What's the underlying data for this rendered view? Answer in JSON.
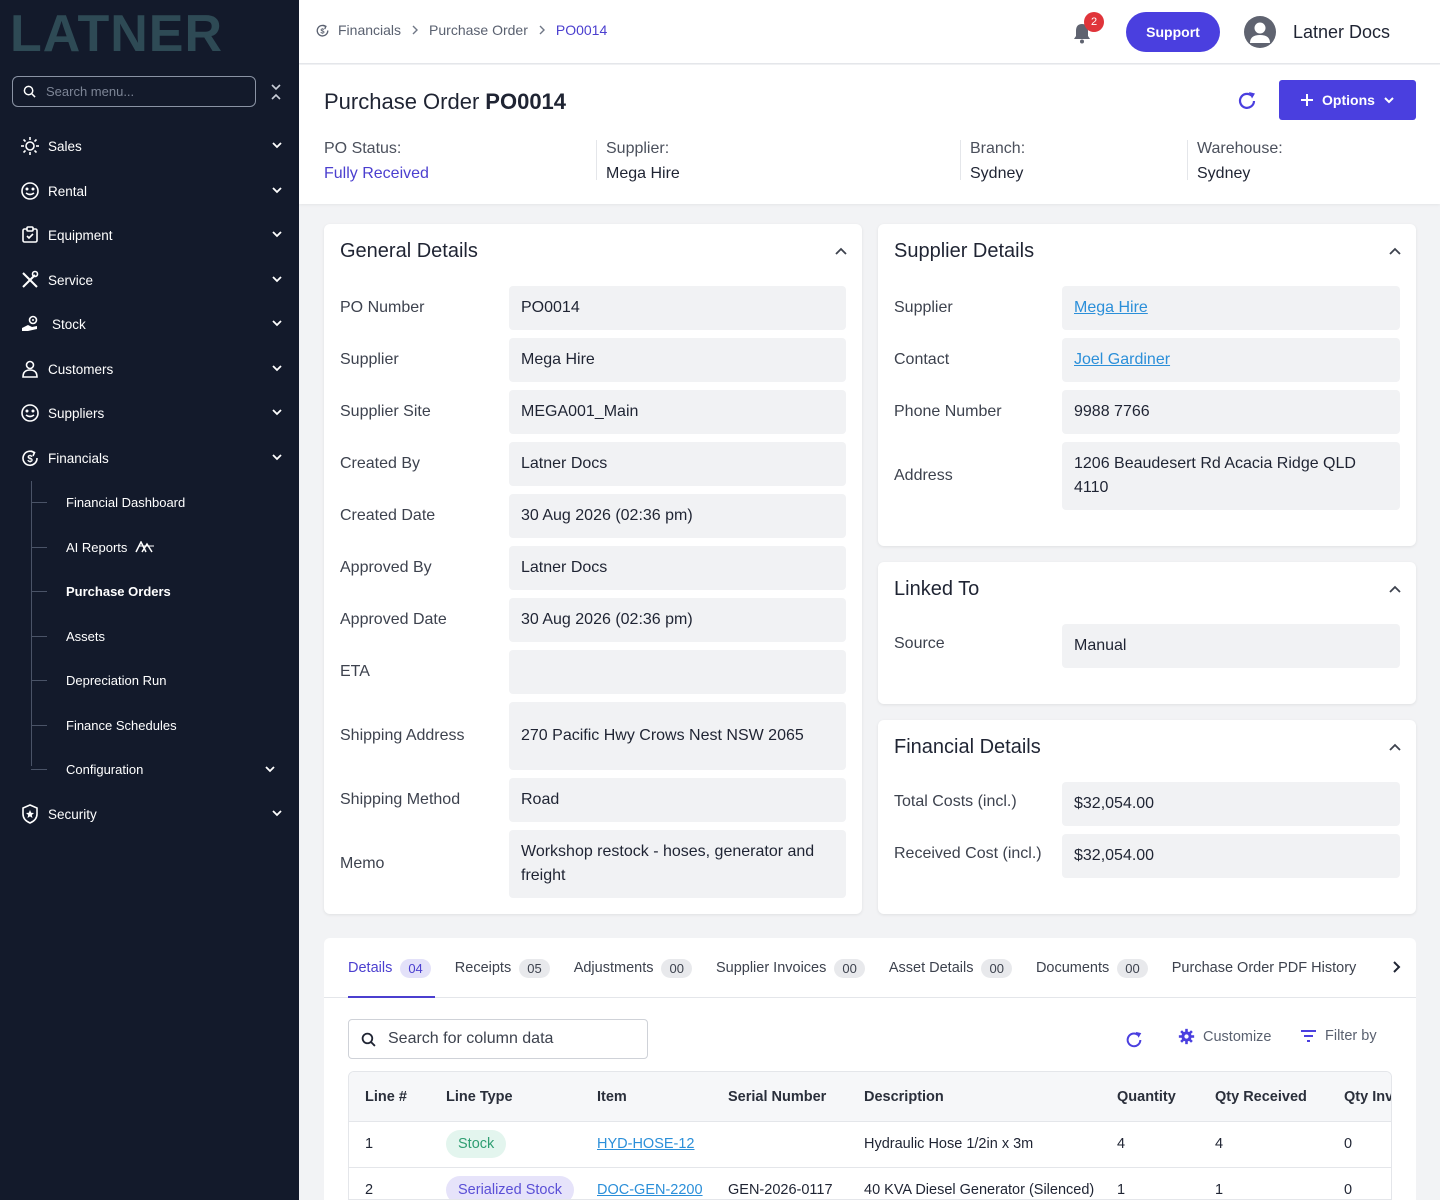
{
  "brand": {
    "logo_text": "LATNER"
  },
  "sidebar": {
    "search_placeholder": "Search menu...",
    "items": [
      {
        "label": "Sales",
        "icon": "sales-icon"
      },
      {
        "label": "Rental",
        "icon": "rental-icon"
      },
      {
        "label": "Equipment",
        "icon": "equipment-icon"
      },
      {
        "label": "Service",
        "icon": "service-icon"
      },
      {
        "label": "Stock",
        "icon": "stock-icon"
      },
      {
        "label": "Customers",
        "icon": "customers-icon"
      },
      {
        "label": "Suppliers",
        "icon": "suppliers-icon"
      },
      {
        "label": "Financials",
        "icon": "financials-icon"
      },
      {
        "label": "Security",
        "icon": "security-icon"
      }
    ],
    "financials_sub": [
      {
        "label": "Financial Dashboard"
      },
      {
        "label": "AI Reports"
      },
      {
        "label": "Purchase Orders",
        "active": true
      },
      {
        "label": "Assets"
      },
      {
        "label": "Depreciation Run"
      },
      {
        "label": "Finance Schedules"
      },
      {
        "label": "Configuration"
      }
    ]
  },
  "topbar": {
    "breadcrumb": [
      "Financials",
      "Purchase Order",
      "PO0014"
    ],
    "notification_count": "2",
    "support_label": "Support",
    "user_name": "Latner Docs"
  },
  "header": {
    "title_prefix": "Purchase Order",
    "title_id": "PO0014",
    "options_label": "Options",
    "fields": [
      {
        "label": "PO Status:",
        "value": "Fully Received"
      },
      {
        "label": "Supplier:",
        "value": "Mega Hire"
      },
      {
        "label": "Branch:",
        "value": "Sydney"
      },
      {
        "label": "Warehouse:",
        "value": "Sydney"
      }
    ]
  },
  "general_details": {
    "title": "General Details",
    "rows": [
      {
        "label": "PO Number",
        "value": "PO0014"
      },
      {
        "label": "Supplier",
        "value": "Mega Hire"
      },
      {
        "label": "Supplier Site",
        "value": "MEGA001_Main"
      },
      {
        "label": "Created By",
        "value": "Latner Docs"
      },
      {
        "label": "Created Date",
        "value": "30 Aug 2026 (02:36 pm)"
      },
      {
        "label": "Approved By",
        "value": "Latner Docs"
      },
      {
        "label": "Approved Date",
        "value": "30 Aug 2026 (02:36 pm)"
      },
      {
        "label": "ETA",
        "value": ""
      },
      {
        "label": "Shipping Address",
        "value": "270 Pacific Hwy Crows Nest NSW 2065"
      },
      {
        "label": "Shipping Method",
        "value": "Road"
      },
      {
        "label": "Memo",
        "value": "Workshop restock - hoses, generator and freight"
      }
    ]
  },
  "supplier_details": {
    "title": "Supplier Details",
    "rows": [
      {
        "label": "Supplier",
        "value": "Mega Hire"
      },
      {
        "label": "Contact",
        "value": "Joel Gardiner"
      },
      {
        "label": "Phone Number",
        "value": "9988 7766"
      },
      {
        "label": "Address",
        "value": "1206 Beaudesert Rd Acacia Ridge QLD 4110"
      }
    ]
  },
  "linked_to": {
    "title": "Linked To",
    "rows": [
      {
        "label": "Source",
        "value": "Manual"
      }
    ]
  },
  "financial_details": {
    "title": "Financial Details",
    "rows": [
      {
        "label": "Total Costs (incl.)",
        "value": "$32,054.00"
      },
      {
        "label": "Received Cost (incl.)",
        "value": "$32,054.00"
      }
    ]
  },
  "tabs": [
    {
      "label": "Details",
      "count": "04"
    },
    {
      "label": "Receipts",
      "count": "05"
    },
    {
      "label": "Adjustments",
      "count": "00"
    },
    {
      "label": "Supplier Invoices",
      "count": "00"
    },
    {
      "label": "Asset Details",
      "count": "00"
    },
    {
      "label": "Documents",
      "count": "00"
    },
    {
      "label": "Purchase Order PDF History"
    }
  ],
  "table_toolbar": {
    "search_placeholder": "Search for column data",
    "customize_label": "Customize",
    "filter_label": "Filter by"
  },
  "table": {
    "columns": [
      "Line #",
      "Line Type",
      "Item",
      "Serial Number",
      "Description",
      "Quantity",
      "Qty Received",
      "Qty Inv"
    ],
    "rows": [
      {
        "line": "1",
        "type": "Stock",
        "item": "HYD-HOSE-12",
        "serial": "",
        "description": "Hydraulic Hose 1/2in x 3m",
        "qty": "4",
        "received": "4",
        "invoiced": "0"
      },
      {
        "line": "2",
        "type": "Serialized Stock",
        "item": "DOC-GEN-2200",
        "serial": "GEN-2026-0117",
        "description": "40 KVA Diesel Generator (Silenced)",
        "qty": "1",
        "received": "1",
        "invoiced": "0"
      }
    ]
  },
  "colors": {
    "sidebar_bg": "#131a2b",
    "accent": "#4a3fdf",
    "link": "#2b8fd9",
    "logo_teal": "#2e4a55",
    "stock_pill_bg": "#e3f5ee",
    "stock_pill_text": "#2f9e72",
    "serialized_pill_bg": "#e6e3fa",
    "serialized_pill_text": "#5a4fd6"
  }
}
